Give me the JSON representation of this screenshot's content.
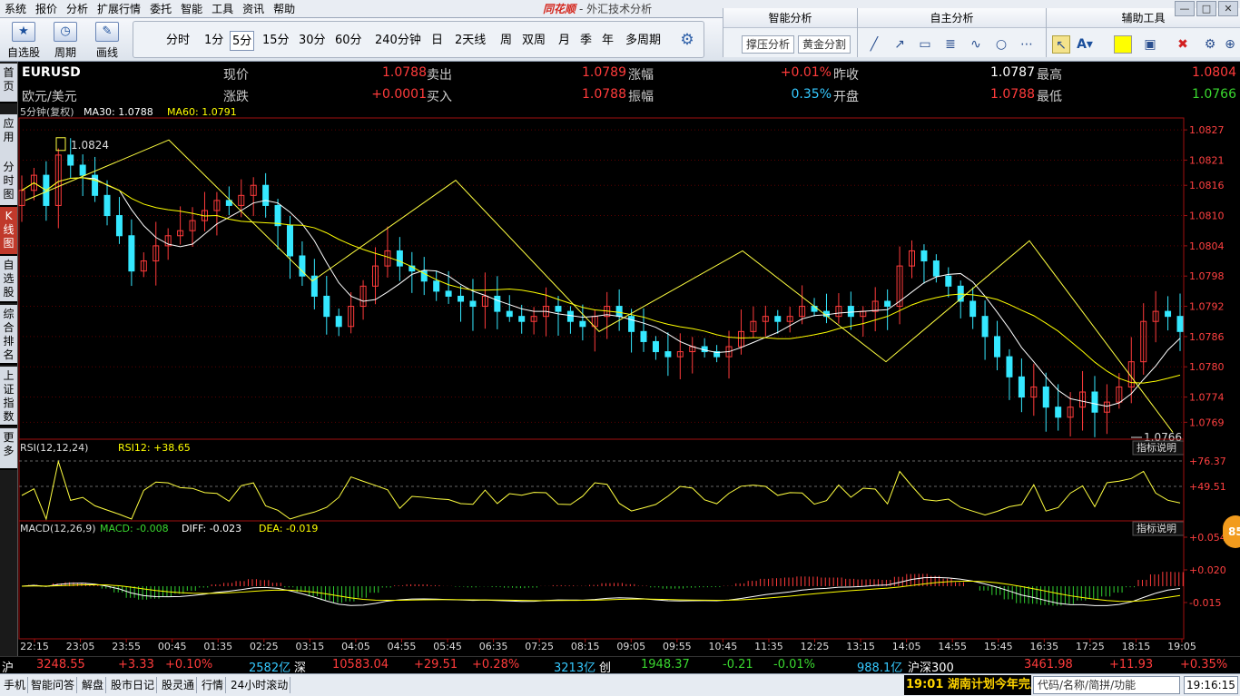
{
  "menu": [
    "系统",
    "报价",
    "分析",
    "扩展行情",
    "委托",
    "智能",
    "工具",
    "资讯",
    "帮助"
  ],
  "brand": {
    "logo": "同花顺",
    "title": "- 外汇技术分析"
  },
  "toolbar": {
    "left_buttons": [
      {
        "label": "自选股",
        "icon": "star-icon",
        "glyph": "★"
      },
      {
        "label": "周期",
        "icon": "clock-icon",
        "glyph": "◷"
      },
      {
        "label": "画线",
        "icon": "pencil-icon",
        "glyph": "✎"
      }
    ],
    "periods": [
      "分时",
      "1分",
      "5分",
      "15分",
      "30分",
      "60分",
      "240分钟",
      "日",
      "2天线",
      "周",
      "双周",
      "月",
      "季",
      "年",
      "多周期"
    ],
    "active_period": "5分",
    "smart_analysis": {
      "title": "智能分析",
      "items": [
        "撑压分析",
        "黄金分割"
      ]
    },
    "self_analysis": {
      "title": "自主分析"
    },
    "aux_tools": {
      "title": "辅助工具"
    }
  },
  "side_tabs": [
    "首页",
    "应用",
    "分时图",
    "K线图",
    "自选股",
    "综合排名",
    "上证指数",
    "更多"
  ],
  "quote": {
    "symbol": "EURUSD",
    "name": "欧元/美元",
    "current_label": "现价",
    "current": "1.0788",
    "sell_label": "卖出",
    "sell": "1.0789",
    "chg_pct_label": "涨幅",
    "chg_pct": "+0.01%",
    "prev_close_label": "昨收",
    "prev_close": "1.0787",
    "high_label": "最高",
    "high": "1.0804",
    "change_label": "涨跌",
    "change": "+0.0001",
    "buy_label": "买入",
    "buy": "1.0788",
    "amp_label": "振幅",
    "amp": "0.35%",
    "open_label": "开盘",
    "open": "1.0788",
    "low_label": "最低",
    "low": "1.0766"
  },
  "chart_data": {
    "type": "candlestick",
    "period_label": "5分钟(复权)",
    "ma30": "MA30: 1.0788",
    "ma60": "MA60: 1.0791",
    "y_ticks": [
      "1.0827",
      "1.0821",
      "1.0816",
      "1.0810",
      "1.0804",
      "1.0798",
      "1.0792",
      "1.0786",
      "1.0780",
      "1.0774",
      "1.0769"
    ],
    "ylim": [
      1.0766,
      1.0829
    ],
    "x_ticks": [
      "22:15",
      "23:05",
      "23:55",
      "00:45",
      "01:35",
      "02:25",
      "03:15",
      "04:05",
      "04:55",
      "05:45",
      "06:35",
      "07:25",
      "08:15",
      "09:05",
      "09:55",
      "10:45",
      "11:35",
      "12:25",
      "13:15",
      "14:05",
      "14:55",
      "15:45",
      "16:35",
      "17:25",
      "18:15",
      "19:05"
    ],
    "high_mark": "1.0824",
    "low_mark": "1.0766",
    "zigzag": [
      1.0813,
      1.0825,
      1.0797,
      1.0817,
      1.0787,
      1.0803,
      1.0781,
      1.0805,
      1.0767
    ],
    "closes": [
      1.0815,
      1.0818,
      1.0812,
      1.0822,
      1.082,
      1.0818,
      1.0814,
      1.081,
      1.0806,
      1.0799,
      1.0801,
      1.0804,
      1.0806,
      1.0807,
      1.0809,
      1.0811,
      1.0813,
      1.0812,
      1.0814,
      1.0816,
      1.0812,
      1.0808,
      1.0802,
      1.0798,
      1.0794,
      1.079,
      1.0788,
      1.0792,
      1.0796,
      1.08,
      1.0803,
      1.08,
      1.0799,
      1.0797,
      1.0795,
      1.0794,
      1.0793,
      1.0792,
      1.0794,
      1.0791,
      1.079,
      1.0789,
      1.079,
      1.0792,
      1.0791,
      1.0789,
      1.0788,
      1.079,
      1.0792,
      1.079,
      1.0787,
      1.0785,
      1.0783,
      1.0782,
      1.0783,
      1.0784,
      1.0783,
      1.0782,
      1.0784,
      1.0787,
      1.0789,
      1.079,
      1.0789,
      1.079,
      1.0792,
      1.0791,
      1.079,
      1.0792,
      1.079,
      1.0791,
      1.0793,
      1.0792,
      1.08,
      1.0803,
      1.0801,
      1.0798,
      1.0796,
      1.0793,
      1.079,
      1.0786,
      1.0782,
      1.0778,
      1.0774,
      1.0776,
      1.0772,
      1.077,
      1.0772,
      1.0775,
      1.0771,
      1.0773,
      1.0776,
      1.0781,
      1.0789,
      1.0791,
      1.079,
      1.0787
    ],
    "indicators": {
      "rsi": {
        "label": "RSI(12,12,24)",
        "value": "RSI12: +38.65",
        "ticks": [
          "+76.37",
          "+49.51"
        ],
        "explain": "指标说明"
      },
      "macd": {
        "label": "MACD(12,26,9)",
        "macd": "MACD: -0.008",
        "diff": "DIFF: -0.023",
        "dea": "DEA: -0.019",
        "ticks": [
          "+0.054",
          "+0.020",
          "-0.015"
        ],
        "explain": "指标说明"
      }
    }
  },
  "status": {
    "sh": {
      "label": "沪",
      "value": "3248.55",
      "change": "+3.33",
      "pct": "+0.10%",
      "amount": "2582亿"
    },
    "sz": {
      "label": "深",
      "value": "10583.04",
      "change": "+29.51",
      "pct": "+0.28%",
      "amount": "3213亿"
    },
    "cy": {
      "label": "创",
      "value": "1948.37",
      "change": "-0.21",
      "pct": "-0.01%",
      "amount": "988.1亿"
    },
    "hs300": {
      "label": "沪深300",
      "value": "3461.98",
      "change": "+11.93",
      "pct": "+0.35%"
    }
  },
  "bottom": {
    "buttons": [
      "手机",
      "智能问答",
      "解盘",
      "股市日记",
      "股灵通",
      "行情",
      "24小时滚动"
    ],
    "ticker": "19:01 湖南计划今年完成",
    "search_placeholder": "代码/名称/简拼/功能",
    "clock": "19:16:15",
    "badge": "85"
  },
  "colors": {
    "up": "#ff3b3b",
    "down": "#35e8ff",
    "ma30": "#ffffff",
    "ma60": "#ffff00",
    "grid": "#5a0000",
    "axis": "#a01010"
  }
}
